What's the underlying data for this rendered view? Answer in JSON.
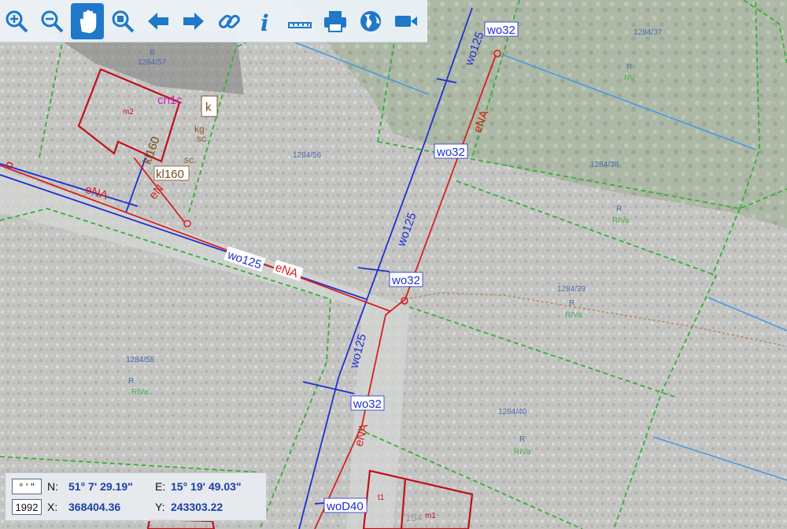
{
  "toolbar": {
    "tools": [
      {
        "name": "zoom-in-button",
        "icon": "zoom-in-icon"
      },
      {
        "name": "zoom-out-button",
        "icon": "zoom-out-icon"
      },
      {
        "name": "pan-button",
        "icon": "hand-icon",
        "active": true
      },
      {
        "name": "zoom-extent-button",
        "icon": "zoom-extent-icon"
      },
      {
        "name": "back-button",
        "icon": "arrow-left-icon"
      },
      {
        "name": "forward-button",
        "icon": "arrow-right-icon"
      },
      {
        "name": "link-button",
        "icon": "link-icon"
      },
      {
        "name": "info-button",
        "icon": "info-icon"
      },
      {
        "name": "measure-button",
        "icon": "ruler-icon"
      },
      {
        "name": "print-button",
        "icon": "printer-icon"
      },
      {
        "name": "globe-button",
        "icon": "globe-icon"
      },
      {
        "name": "video-button",
        "icon": "video-camera-icon"
      }
    ]
  },
  "coords": {
    "format_label": "° ' \"",
    "system_label": "1992",
    "n_label": "N:",
    "n_value": "51° 7' 29.19\"",
    "e_label": "E:",
    "e_value": "15° 19' 49.03\"",
    "x_label": "X:",
    "x_value": "368404.36",
    "y_label": "Y:",
    "y_value": "243303.22"
  },
  "map": {
    "parcels": [
      "1284/57",
      "1284/56",
      "1284/37",
      "1284/38",
      "1284/39",
      "1284/40",
      "1284/55"
    ],
    "land_use": [
      "B",
      "R",
      "RV",
      "R",
      "RIVa",
      "R",
      "RIVa",
      "R",
      "RIVa",
      "R",
      "RIVa"
    ],
    "pipe_labels": [
      "wo32",
      "wo125",
      "wo32",
      "wo125",
      "wo32",
      "wo125",
      "wo32",
      "wo125",
      "woD40",
      "eNA",
      "eNA",
      "eNA",
      "eNA",
      "eN",
      "kl160",
      "kl160",
      "cn1c",
      "k",
      "kg",
      "sc",
      "sc",
      "m2",
      "m1",
      "t1",
      "154"
    ]
  },
  "colors": {
    "water": "#1f2fd0",
    "power": "#d8201c",
    "building": "#c01018",
    "parcel_border": "#35b035",
    "parcel_label": "#4a6aa8",
    "land_use": "#48b048",
    "sewer": "#a86a2a"
  }
}
